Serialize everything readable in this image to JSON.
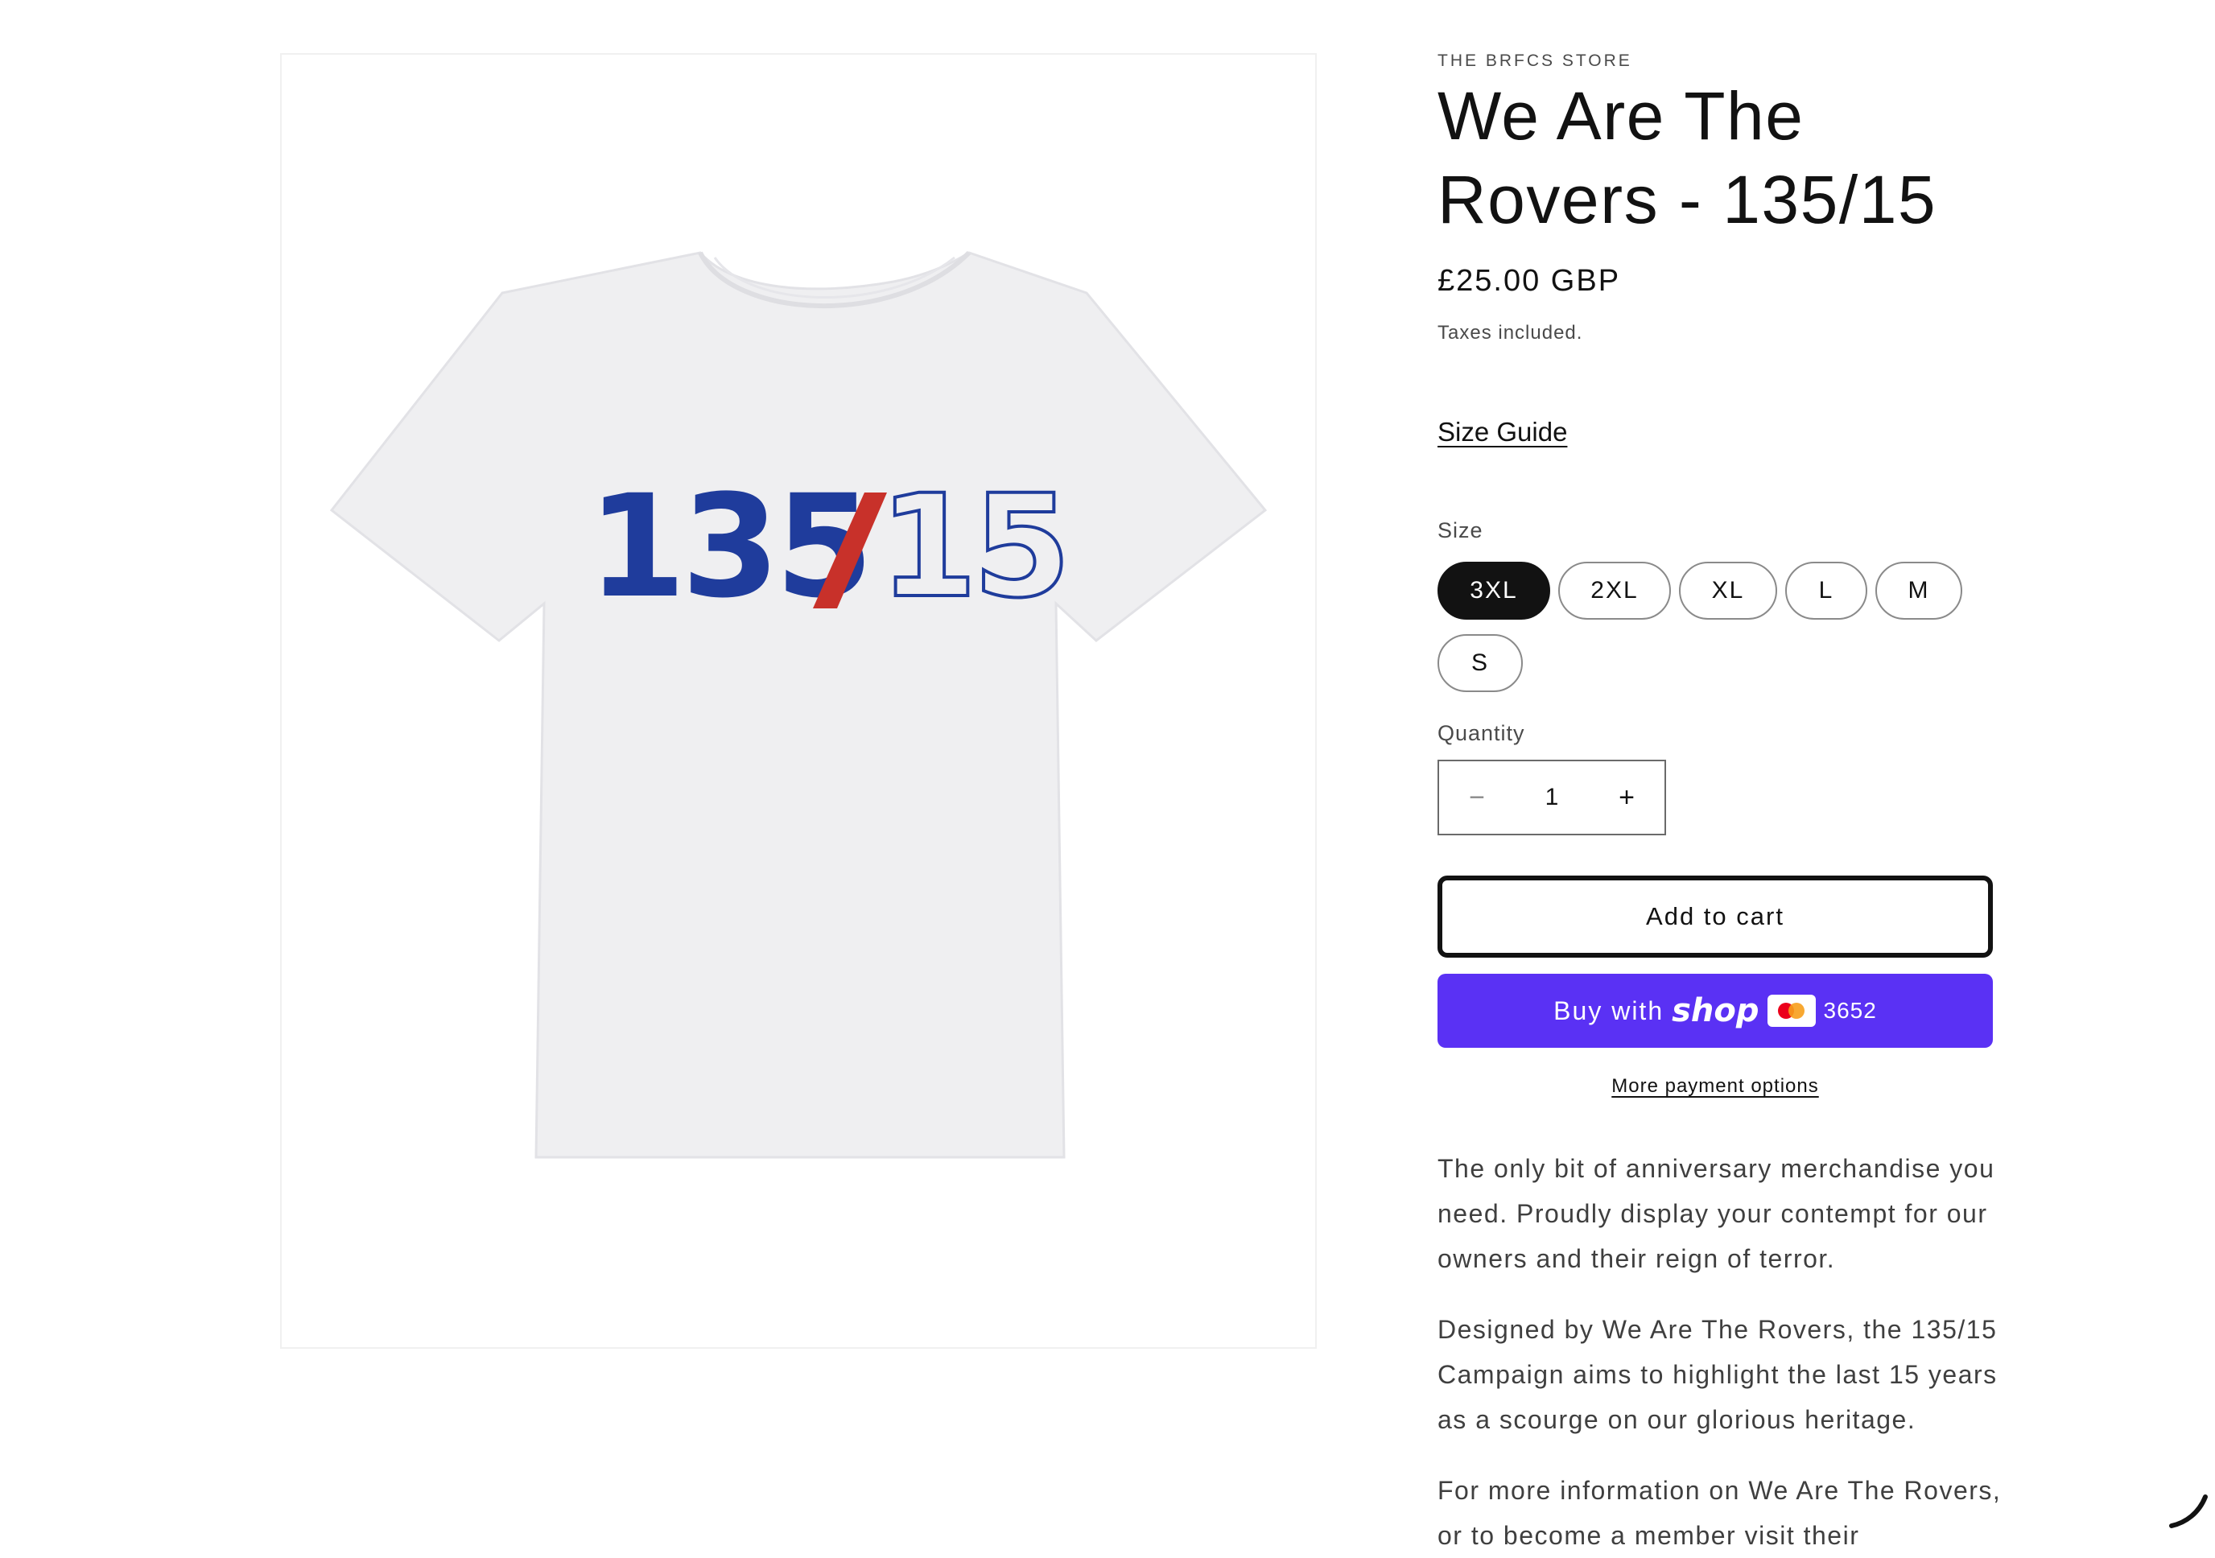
{
  "product": {
    "vendor": "THE BRFCS STORE",
    "title": "We Are The Rovers - 135/15",
    "price": "£25.00 GBP",
    "tax_note": "Taxes included.",
    "size_guide_label": "Size Guide",
    "size_label": "Size",
    "sizes": [
      "3XL",
      "2XL",
      "XL",
      "L",
      "M",
      "S"
    ],
    "selected_size": "3XL",
    "quantity_label": "Quantity",
    "quantity": "1",
    "minus_symbol": "−",
    "plus_symbol": "+",
    "add_to_cart_label": "Add to cart",
    "buy_with_label": "Buy with",
    "shop_pay_brand": "shop",
    "card_last4": "3652",
    "more_payment_label": "More payment options",
    "description": [
      "The only bit of anniversary merchandise you need. Proudly display your contempt for our owners and their reign of terror.",
      "Designed by We Are The Rovers, the 135/15 Campaign aims to highlight the last 15 years as a scourge on our glorious heritage.",
      "For more information on We Are The Rovers, or to become a member visit their"
    ]
  },
  "image": {
    "print_text_left": "135",
    "print_slash": "/",
    "print_text_right": "15",
    "colors": {
      "shirt": "#efeff1",
      "blue": "#1f3c9c",
      "red": "#c8312a"
    }
  },
  "icons": {
    "card": "card-icon",
    "spinner": "loading-spinner-icon"
  },
  "colors": {
    "shop_pay_purple": "#5a31f4",
    "selected_pill": "#121212"
  }
}
